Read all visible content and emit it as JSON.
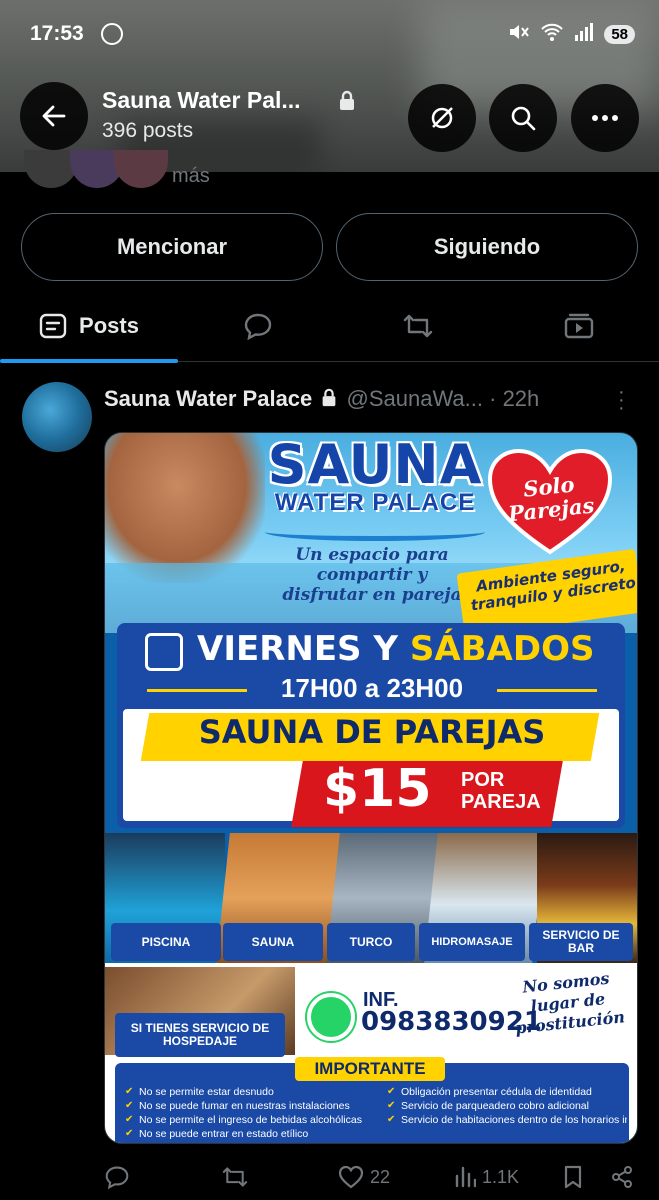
{
  "status_bar": {
    "time": "17:53",
    "battery": "58"
  },
  "header": {
    "title": "Sauna Water Pal...",
    "posts_count": "396 posts"
  },
  "profile": {
    "peek_text": "más"
  },
  "buttons": {
    "mention": "Mencionar",
    "following": "Siguiendo"
  },
  "tabs": [
    {
      "label": "Posts"
    }
  ],
  "post": {
    "display_name": "Sauna Water Palace",
    "handle": "@SaunaWa...",
    "time": "· 22h",
    "replies": "",
    "likes": "22",
    "views": "1.1K"
  },
  "flyer": {
    "logo_line1": "SAUNA",
    "logo_line2": "WATER PALACE",
    "tagline": "Un espacio para compartir y disfrutar en pareja",
    "heart_text": "Solo Parejas",
    "ambient": "Ambiente seguro, tranquilo y discreto",
    "days_part1": "VIERNES Y ",
    "days_part2": "SÁBADOS",
    "hours": "17H00 a 23H00",
    "headline": "SAUNA DE PAREJAS",
    "price": "$15",
    "per_couple": "POR PAREJA",
    "services": [
      "PISCINA",
      "SAUNA",
      "TURCO",
      "HIDROMASAJE",
      "SERVICIO DE BAR"
    ],
    "lodging": "SI TIENES SERVICIO DE HOSPEDAJE",
    "info_label": "INF.",
    "phone": "0983830921",
    "disclaimer": "No somos lugar de prostitución",
    "important_title": "IMPORTANTE",
    "rules_left": [
      "No se permite estar desnudo",
      "No se puede fumar en nuestras instalaciones",
      "No se permite el ingreso de bebidas alcohólicas",
      "No se puede entrar en estado etílico"
    ],
    "rules_right": [
      "Obligación presentar cédula de identidad",
      "Servicio de parqueadero cobro adicional",
      "Servicio de habitaciones dentro de los horarios indicados"
    ]
  },
  "colors": {
    "accent": "#1d9bf0",
    "background": "#000000",
    "muted_text": "#71767b"
  }
}
